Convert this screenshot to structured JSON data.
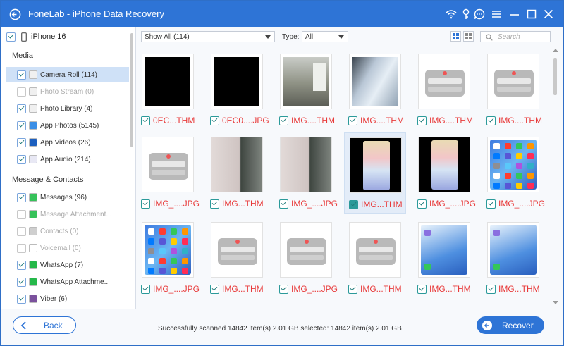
{
  "app": {
    "title": "FoneLab - iPhone Data Recovery",
    "accent": "#2e74d6",
    "window_icons": [
      "wifi-icon",
      "key-icon",
      "chat-icon",
      "menu-icon",
      "minimize-icon",
      "maximize-icon",
      "close-icon"
    ]
  },
  "sidebar": {
    "device": "iPhone 16",
    "sections": [
      {
        "title": "Media",
        "items": [
          {
            "label": "Camera Roll (114)",
            "checked": true,
            "selected": true,
            "disabled": false,
            "icon": "camera-roll-icon"
          },
          {
            "label": "Photo Stream (0)",
            "checked": false,
            "selected": false,
            "disabled": true,
            "icon": "photo-stream-icon"
          },
          {
            "label": "Photo Library (4)",
            "checked": true,
            "selected": false,
            "disabled": false,
            "icon": "photo-library-icon"
          },
          {
            "label": "App Photos (5145)",
            "checked": true,
            "selected": false,
            "disabled": false,
            "icon": "app-photos-icon"
          },
          {
            "label": "App Videos (26)",
            "checked": true,
            "selected": false,
            "disabled": false,
            "icon": "app-videos-icon"
          },
          {
            "label": "App Audio (214)",
            "checked": true,
            "selected": false,
            "disabled": false,
            "icon": "app-audio-icon"
          }
        ]
      },
      {
        "title": "Message & Contacts",
        "items": [
          {
            "label": "Messages (96)",
            "checked": true,
            "selected": false,
            "disabled": false,
            "icon": "messages-icon"
          },
          {
            "label": "Message Attachment...",
            "checked": false,
            "selected": false,
            "disabled": true,
            "icon": "message-attachments-icon"
          },
          {
            "label": "Contacts (0)",
            "checked": false,
            "selected": false,
            "disabled": true,
            "icon": "contacts-icon"
          },
          {
            "label": "Voicemail (0)",
            "checked": false,
            "selected": false,
            "disabled": true,
            "icon": "voicemail-icon"
          },
          {
            "label": "WhatsApp (7)",
            "checked": true,
            "selected": false,
            "disabled": false,
            "icon": "whatsapp-icon"
          },
          {
            "label": "WhatsApp Attachme...",
            "checked": true,
            "selected": false,
            "disabled": false,
            "icon": "whatsapp-attachments-icon"
          },
          {
            "label": "Viber (6)",
            "checked": true,
            "selected": false,
            "disabled": false,
            "icon": "viber-icon"
          }
        ]
      }
    ]
  },
  "toolbar": {
    "filter_value": "Show All (114)",
    "type_label": "Type:",
    "type_value": "All",
    "search_placeholder": "Search",
    "view_modes": [
      "grid-view-icon",
      "list-view-icon"
    ]
  },
  "grid": {
    "items": [
      {
        "name": "0EC...THM",
        "thumb": "black",
        "checked": true,
        "highlighted": false
      },
      {
        "name": "0EC0....JPG",
        "thumb": "black",
        "checked": true,
        "highlighted": false
      },
      {
        "name": "IMG....THM",
        "thumb": "office",
        "checked": true,
        "highlighted": false
      },
      {
        "name": "IMG....THM",
        "thumb": "screen",
        "checked": true,
        "highlighted": false
      },
      {
        "name": "IMG....THM",
        "thumb": "popup",
        "checked": true,
        "highlighted": false
      },
      {
        "name": "IMG....THM",
        "thumb": "popup",
        "checked": true,
        "highlighted": false
      },
      {
        "name": "IMG_....JPG",
        "thumb": "popup",
        "checked": true,
        "highlighted": false
      },
      {
        "name": "IMG...THM",
        "thumb": "wall",
        "checked": true,
        "highlighted": false
      },
      {
        "name": "IMG_....JPG",
        "thumb": "wall",
        "checked": true,
        "highlighted": false
      },
      {
        "name": "IMG...THM",
        "thumb": "anime",
        "checked": true,
        "highlighted": true
      },
      {
        "name": "IMG_....JPG",
        "thumb": "anime",
        "checked": true,
        "highlighted": false
      },
      {
        "name": "IMG_....JPG",
        "thumb": "ios",
        "checked": true,
        "highlighted": false
      },
      {
        "name": "IMG_....JPG",
        "thumb": "ios",
        "checked": true,
        "highlighted": false
      },
      {
        "name": "IMG...THM",
        "thumb": "popup",
        "checked": true,
        "highlighted": false
      },
      {
        "name": "IMG_....JPG",
        "thumb": "popup",
        "checked": true,
        "highlighted": false
      },
      {
        "name": "IMG...THM",
        "thumb": "popup",
        "checked": true,
        "highlighted": false
      },
      {
        "name": "IMG...THM",
        "thumb": "blue",
        "checked": true,
        "highlighted": false
      },
      {
        "name": "IMG...THM",
        "thumb": "blue",
        "checked": true,
        "highlighted": false
      }
    ]
  },
  "footer": {
    "back_label": "Back",
    "status": "Successfully scanned 14842 item(s) 2.01 GB   selected: 14842 item(s) 2.01 GB",
    "recover_label": "Recover"
  }
}
